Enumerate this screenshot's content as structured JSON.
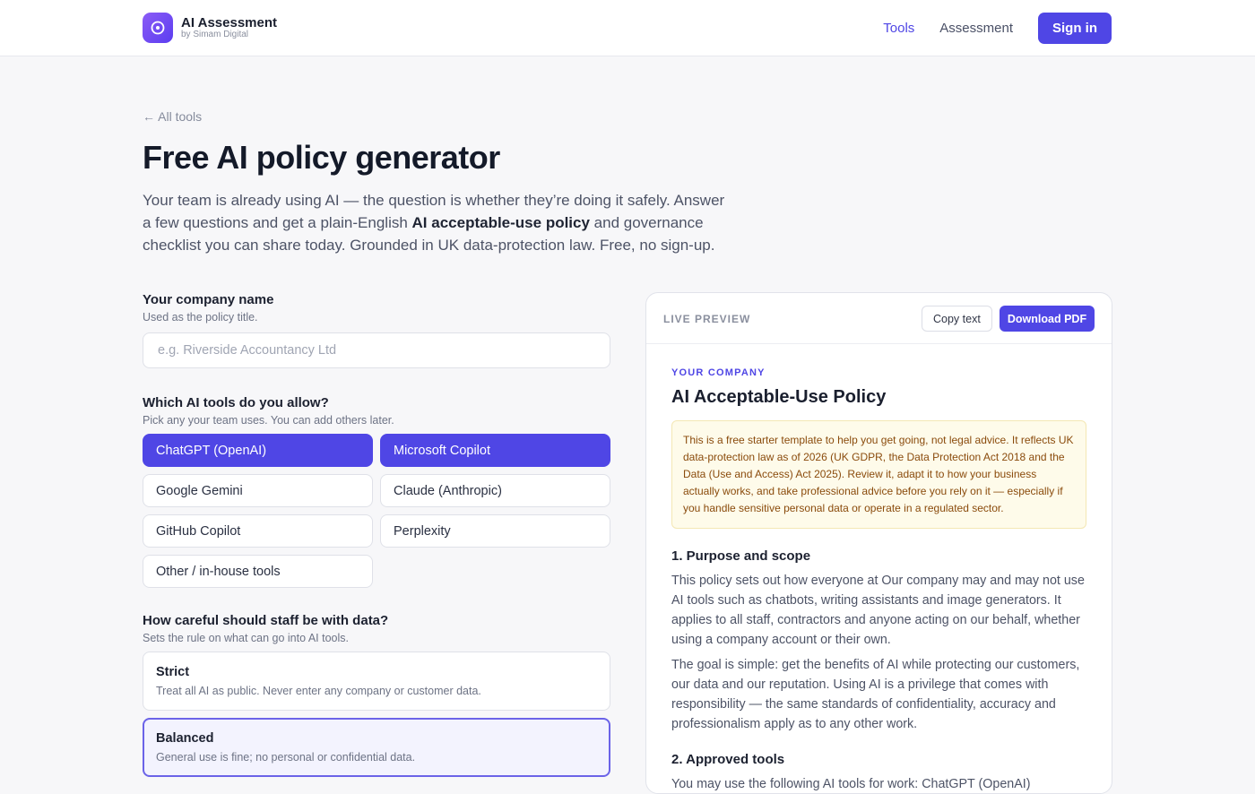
{
  "header": {
    "brand_title": "AI Assessment",
    "brand_sub": "by Simam Digital",
    "nav": [
      {
        "label": "Tools"
      },
      {
        "label": "Assessment"
      }
    ],
    "signin_label": "Sign in"
  },
  "page": {
    "back_link": "← All tools",
    "title": "Free AI policy generator",
    "intro_before": "Your team is already using AI — the question is whether they’re doing it safely. Answer a few questions and get a plain-English ",
    "intro_bold": "AI acceptable-use policy",
    "intro_after": " and governance checklist you can share today. Grounded in UK data-protection law. Free, no sign-up."
  },
  "form": {
    "company": {
      "label": "Your company name",
      "help": "Used as the policy title.",
      "placeholder": "e.g. Riverside Accountancy Ltd",
      "value": ""
    },
    "tools": {
      "label": "Which AI tools do you allow?",
      "help": "Pick any your team uses. You can add others later.",
      "options": [
        {
          "label": "ChatGPT (OpenAI)",
          "selected": true
        },
        {
          "label": "Microsoft Copilot",
          "selected": true
        },
        {
          "label": "Google Gemini",
          "selected": false
        },
        {
          "label": "Claude (Anthropic)",
          "selected": false
        },
        {
          "label": "GitHub Copilot",
          "selected": false
        },
        {
          "label": "Perplexity",
          "selected": false
        },
        {
          "label": "Other / in-house tools",
          "selected": false
        }
      ]
    },
    "care": {
      "label": "How careful should staff be with data?",
      "help": "Sets the rule on what can go into AI tools.",
      "options": [
        {
          "title": "Strict",
          "desc": "Treat all AI as public. Never enter any company or customer data.",
          "selected": false
        },
        {
          "title": "Balanced",
          "desc": "General use is fine; no personal or confidential data.",
          "selected": true
        }
      ]
    }
  },
  "preview": {
    "label": "LIVE PREVIEW",
    "copy_label": "Copy text",
    "pdf_label": "Download PDF",
    "company": "YOUR COMPANY",
    "title": "AI Acceptable-Use Policy",
    "notice": "This is a free starter template to help you get going, not legal advice. It reflects UK data-protection law as of 2026 (UK GDPR, the Data Protection Act 2018 and the Data (Use and Access) Act 2025). Review it, adapt it to how your business actually works, and take professional advice before you rely on it — especially if you handle sensitive personal data or operate in a regulated sector.",
    "sections": [
      {
        "heading": "1. Purpose and scope",
        "paragraphs": [
          "This policy sets out how everyone at Our company may and may not use AI tools such as chatbots, writing assistants and image generators. It applies to all staff, contractors and anyone acting on our behalf, whether using a company account or their own.",
          "The goal is simple: get the benefits of AI while protecting our customers, our data and our reputation. Using AI is a privilege that comes with responsibility — the same standards of confidentiality, accuracy and professionalism apply as to any other work."
        ]
      },
      {
        "heading": "2. Approved tools",
        "paragraphs": [
          "You may use the following AI tools for work: ChatGPT (OpenAI)"
        ]
      }
    ]
  },
  "colors": {
    "accent": "#4f46e5",
    "notice_bg": "#fefbea",
    "notice_text": "#8a4b0c"
  }
}
